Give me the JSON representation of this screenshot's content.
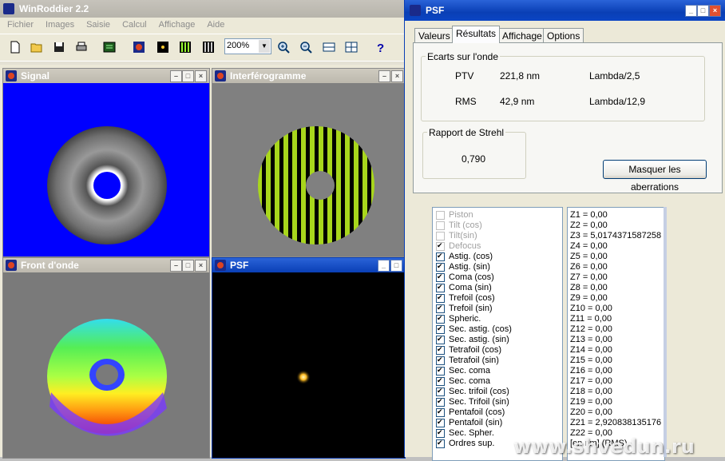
{
  "app": {
    "title": "WinRoddier 2.2",
    "menu": [
      "Fichier",
      "Images",
      "Saisie",
      "Calcul",
      "Affichage",
      "Aide"
    ],
    "zoom_value": "200%"
  },
  "windows": {
    "signal": {
      "title": "Signal"
    },
    "interferogramme": {
      "title": "Interférogramme"
    },
    "front_onde": {
      "title": "Front d'onde"
    },
    "psf": {
      "title": "PSF"
    }
  },
  "dialog": {
    "title": "PSF",
    "tabs": [
      "Valeurs",
      "Résultats",
      "Affichage",
      "Options"
    ],
    "selected_tab": "Résultats",
    "ecarts_group": "Ecarts sur l'onde",
    "ptv": {
      "label": "PTV",
      "value": "221,8 nm",
      "lambda": "Lambda/2,5"
    },
    "rms": {
      "label": "RMS",
      "value": "42,9 nm",
      "lambda": "Lambda/12,9"
    },
    "strehl_group": "Rapport de Strehl",
    "strehl_value": "0,790",
    "masquer_button": "Masquer les aberrations"
  },
  "aberrations": [
    {
      "label": "Piston",
      "checked": false,
      "disabled": true
    },
    {
      "label": "Tilt (cos)",
      "checked": false,
      "disabled": true
    },
    {
      "label": "Tilt(sin)",
      "checked": false,
      "disabled": true
    },
    {
      "label": "Defocus",
      "checked": true,
      "disabled": true
    },
    {
      "label": "Astig. (cos)",
      "checked": true,
      "disabled": false
    },
    {
      "label": "Astig. (sin)",
      "checked": true,
      "disabled": false
    },
    {
      "label": "Coma (cos)",
      "checked": true,
      "disabled": false
    },
    {
      "label": "Coma (sin)",
      "checked": true,
      "disabled": false
    },
    {
      "label": "Trefoil (cos)",
      "checked": true,
      "disabled": false
    },
    {
      "label": "Trefoil (sin)",
      "checked": true,
      "disabled": false
    },
    {
      "label": "Spheric.",
      "checked": true,
      "disabled": false
    },
    {
      "label": "Sec. astig. (cos)",
      "checked": true,
      "disabled": false
    },
    {
      "label": "Sec. astig. (sin)",
      "checked": true,
      "disabled": false
    },
    {
      "label": "Tetrafoil (cos)",
      "checked": true,
      "disabled": false
    },
    {
      "label": "Tetrafoil (sin)",
      "checked": true,
      "disabled": false
    },
    {
      "label": "Sec. coma",
      "checked": true,
      "disabled": false
    },
    {
      "label": "Sec. coma",
      "checked": true,
      "disabled": false
    },
    {
      "label": "Sec. trifoil (cos)",
      "checked": true,
      "disabled": false
    },
    {
      "label": "Sec. Trifoil (sin)",
      "checked": true,
      "disabled": false
    },
    {
      "label": "Pentafoil (cos)",
      "checked": true,
      "disabled": false
    },
    {
      "label": "Pentafoil (sin)",
      "checked": true,
      "disabled": false
    },
    {
      "label": "Sec. Spher.",
      "checked": true,
      "disabled": false
    },
    {
      "label": "Ordres sup.",
      "checked": true,
      "disabled": false
    }
  ],
  "zernike": [
    "Z1 = 0,00",
    "Z2 = 0,00",
    "Z3 = 5,0174371587258",
    "Z4 = 0,00",
    "Z5 = 0,00",
    "Z6 = 0,00",
    "Z7 = 0,00",
    "Z8 = 0,00",
    "Z9 = 0,00",
    "Z10 = 0,00",
    "Z11 = 0,00",
    "Z12 = 0,00",
    "Z13 = 0,00",
    "Z14 = 0,00",
    "Z15 = 0,00",
    "Z16 = 0,00",
    "Z17 = 0,00",
    "Z18 = 0,00",
    "Z19 = 0,00",
    "Z20 = 0,00",
    "Z21 = 2,920838135176",
    "Z22 = 0,00",
    "[en nm] (RMS)"
  ],
  "watermark": "www.shvedun.ru",
  "colors": {
    "signal_bg": "#0000ff",
    "psf_bg": "#000000",
    "xp_blue": "#0a3fb5"
  }
}
